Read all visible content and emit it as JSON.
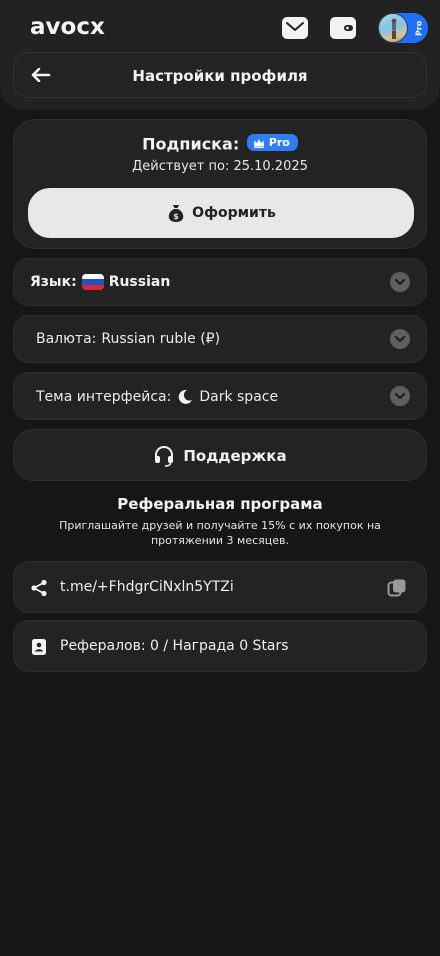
{
  "header": {
    "logo": "avocx",
    "avatar_badge": "Pro",
    "icons": [
      "mail-icon",
      "wallet-icon"
    ]
  },
  "nav": {
    "title": "Настройки профиля"
  },
  "subscription": {
    "label": "Подписка:",
    "badge": "Pro",
    "valid_until": "Действует по: 25.10.2025",
    "button_label": "Оформить"
  },
  "settings": {
    "language_label": "Язык:",
    "language_value": "Russian",
    "currency_label": "Валюта:",
    "currency_value": "Russian ruble (₽)",
    "theme_label": "Тема интерфейса:",
    "theme_value": "Dark space"
  },
  "support": {
    "label": "Поддержка"
  },
  "referral": {
    "title": "Реферальная програма",
    "description": "Приглашайте друзей и получайте 15% с их покупок на протяжении 3 месяцев.",
    "link": "t.me/+FhdgrCiNxln5YTZi",
    "stats": "Рефералов: 0 / Награда 0 Stars"
  },
  "colors": {
    "background": "#161616",
    "card": "#232323",
    "accent": "#2f7df6"
  }
}
